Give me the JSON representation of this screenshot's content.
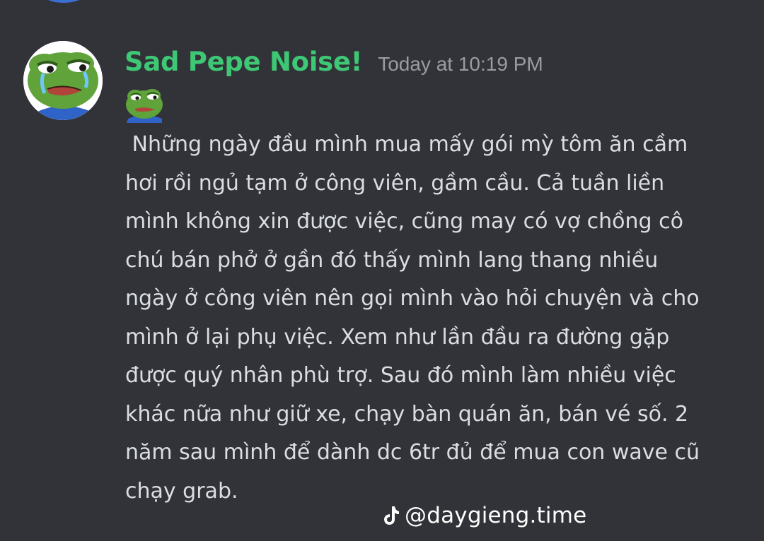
{
  "message": {
    "author": "Sad Pepe Noise!",
    "timestamp": "Today at 10:19 PM",
    "avatar_icon": "pepe-frog-crying-avatar-icon",
    "emoji_icon": "sad-pepe-emoji-icon",
    "body_lines": [
      " Những ngày đầu mình mua mấy gói mỳ tôm ăn cầm",
      "hơi rồi ngủ tạm ở công viên, gầm cầu. Cả tuần liền",
      "mình không xin được việc, cũng may có vợ chồng cô",
      "chú bán phở ở gần đó thấy mình lang thang nhiều",
      "ngày ở công viên nên gọi mình vào hỏi chuyện và cho",
      "mình ở lại phụ việc. Xem như lần đầu ra đường gặp",
      "được quý nhân phù trợ. Sau đó mình làm nhiều việc",
      "khác nữa như giữ xe, chạy bàn quán ăn, bán vé số. 2",
      "năm sau mình để dành dc 6tr đủ để mua con wave cũ",
      "chạy grab."
    ]
  },
  "watermark": {
    "icon": "tiktok-icon",
    "text": "@daygieng.time"
  },
  "colors": {
    "background": "#313338",
    "username": "#3ec774",
    "timestamp": "#9a9ca3",
    "body_text": "#dbdee1"
  }
}
